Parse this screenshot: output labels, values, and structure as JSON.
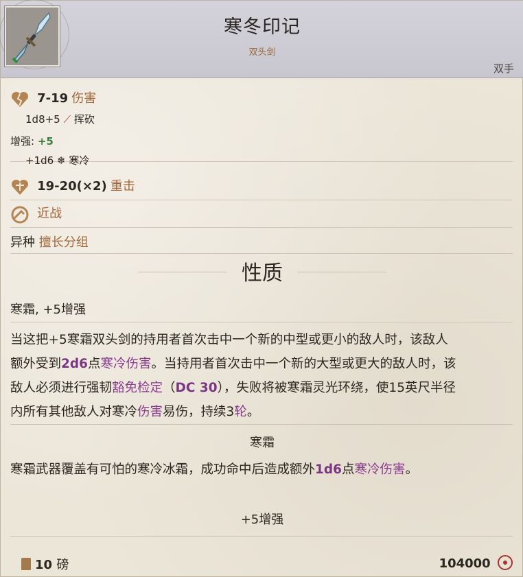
{
  "item": {
    "title": "寒冬印记",
    "subtitle": "双头剑",
    "handedness": "双手",
    "icon": "double-sword-icon"
  },
  "damage": {
    "range": "7-19",
    "label": "伤害",
    "dice": "1d8+5",
    "type": "挥砍",
    "type_icon": "slash-icon",
    "enhance_label": "增强:",
    "enhance_value": "+5",
    "extra_dice": "+1d6",
    "extra_type": "寒冷",
    "extra_icon": "snowflake-icon"
  },
  "crit": {
    "range": "19-20(×2)",
    "label": "重击"
  },
  "attack_type": {
    "label": "近战"
  },
  "group": {
    "prefix": "异种",
    "label": "擅长分组"
  },
  "properties": {
    "title": "性质",
    "tags": "寒霜, +5增强",
    "p1": [
      "当这把+5寒霜双头剑的持用者首次击中一个新的中型或更小的敌人时，该敌人",
      "额外受到",
      "2d6",
      "点",
      "寒冷伤害",
      "。当持用者首次击中一个新的大型或更大的敌人时，该",
      "敌人必须进行强韧",
      "豁免检定",
      "（",
      "DC 30",
      "），失败将被寒霜灵光环绕，使15英尺半径",
      "内所有其他敌人对寒冷",
      "伤害",
      "易伤，持续3",
      "轮",
      "。"
    ],
    "frost_title": "寒霜",
    "p2": [
      "寒霜武器覆盖有可怕的寒冷冰霜，成功命中后造成额外",
      "1d6",
      "点",
      "寒冷伤害",
      "。"
    ],
    "enhance_title": "+5增强"
  },
  "footer": {
    "weight": "10",
    "weight_unit": "磅",
    "price": "104000"
  },
  "colors": {
    "accent": "#a2683c",
    "keyword": "#8a3d8e",
    "positive": "#3f7d3a"
  }
}
